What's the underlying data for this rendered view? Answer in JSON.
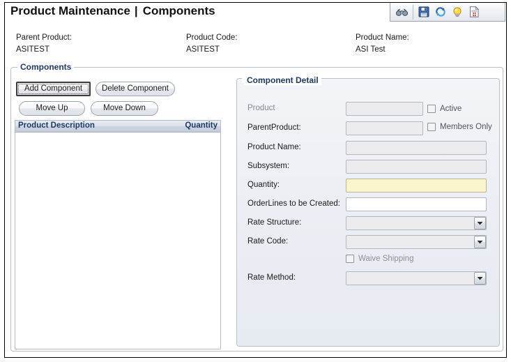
{
  "window": {
    "title_main": "Product Maintenance",
    "title_separator": "|",
    "title_sub": "Components"
  },
  "toolbar": {
    "items": [
      {
        "name": "binoculars-icon",
        "label": "Find"
      },
      {
        "name": "save-icon",
        "label": "Save"
      },
      {
        "name": "refresh-icon",
        "label": "Refresh"
      },
      {
        "name": "lightbulb-icon",
        "label": "Hint"
      },
      {
        "name": "report-icon",
        "label": "Report"
      }
    ]
  },
  "header": {
    "parent_product_label": "Parent Product:",
    "parent_product_value": "ASITEST",
    "product_code_label": "Product Code:",
    "product_code_value": "ASITEST",
    "product_name_label": "Product Name:",
    "product_name_value": "ASI Test"
  },
  "components": {
    "legend": "Components",
    "buttons": {
      "add": "Add Component",
      "delete": "Delete Component",
      "move_up": "Move Up",
      "move_down": "Move Down"
    },
    "grid": {
      "columns": [
        "Product Description",
        "Quantity"
      ],
      "rows": []
    }
  },
  "detail": {
    "legend": "Component Detail",
    "fields": {
      "product_label": "Product",
      "product_value": "",
      "parent_product_label": "ParentProduct:",
      "parent_product_value": "",
      "product_name_label": "Product Name:",
      "product_name_value": "",
      "subsystem_label": "Subsystem:",
      "subsystem_value": "",
      "quantity_label": "Quantity:",
      "quantity_value": "",
      "orderlines_label": "OrderLines to be Created:",
      "orderlines_value": "",
      "rate_structure_label": "Rate Structure:",
      "rate_structure_value": "",
      "rate_code_label": "Rate Code:",
      "rate_code_value": "",
      "rate_method_label": "Rate Method:",
      "rate_method_value": ""
    },
    "checkboxes": {
      "active": "Active",
      "members_only": "Members Only",
      "waive_shipping": "Waive Shipping"
    }
  },
  "colors": {
    "legend_navy": "#1f3864",
    "required_field": "#fbf5cd",
    "panel_bg": "#eceff4",
    "grid_header": "#d4dbe6"
  }
}
